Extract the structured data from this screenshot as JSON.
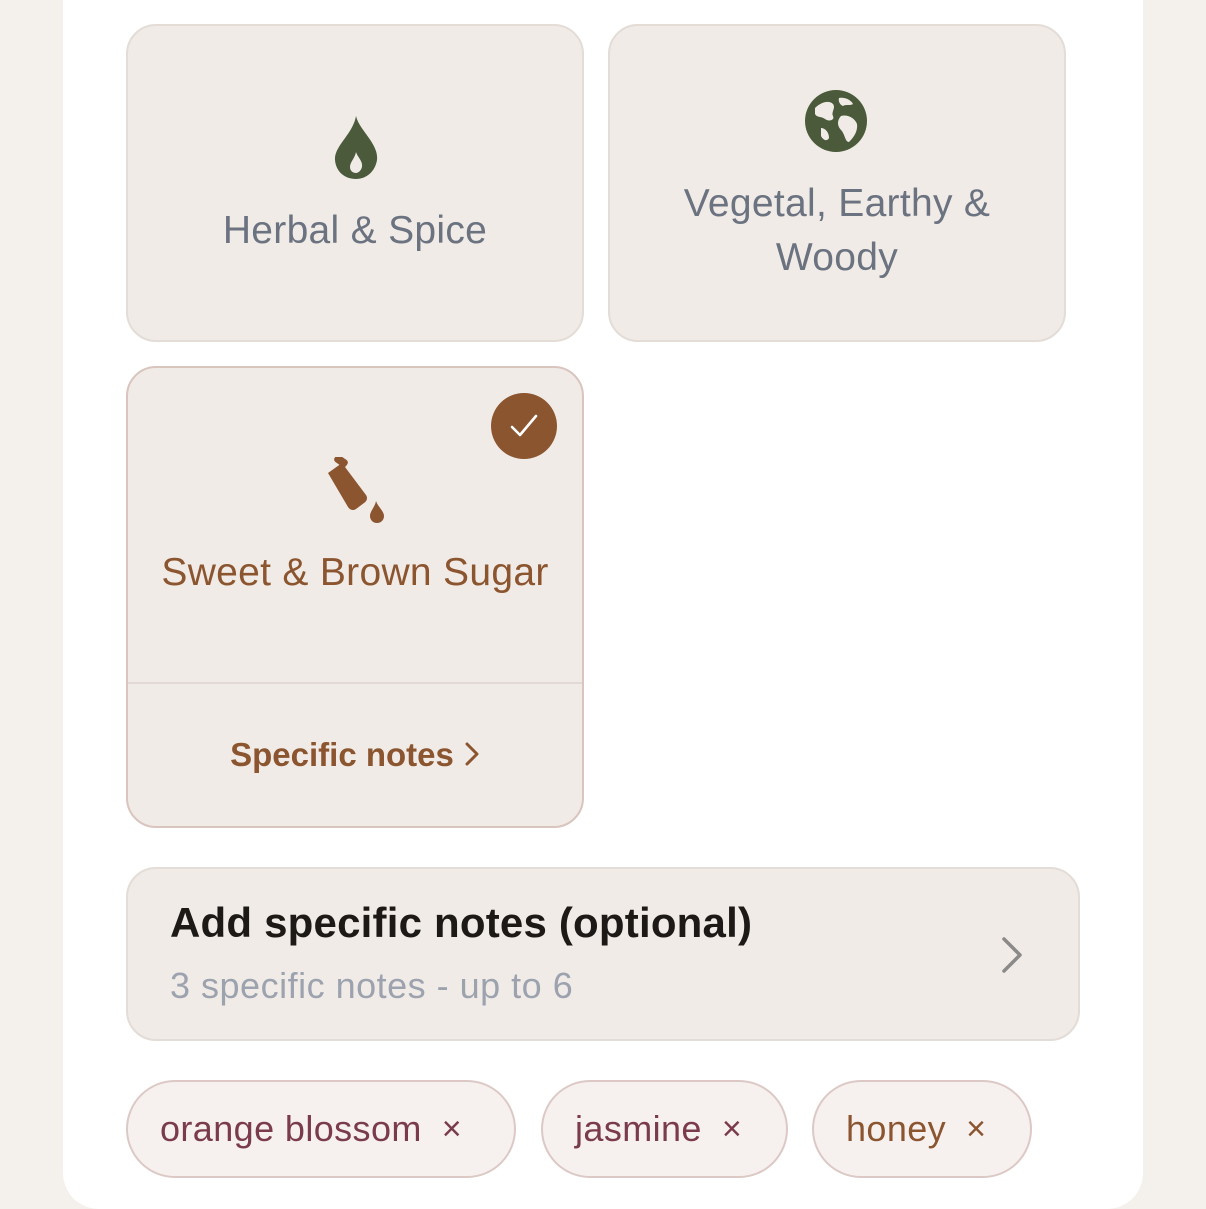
{
  "categories": [
    {
      "label": "Herbal & Spice",
      "icon": "fire-icon",
      "selected": false
    },
    {
      "label": "Vegetal, Earthy & Woody",
      "icon": "globe-icon",
      "selected": false
    },
    {
      "label": "Sweet & Brown Sugar",
      "icon": "honey-pour-icon",
      "selected": true,
      "link_label": "Specific notes"
    }
  ],
  "add_notes": {
    "title": "Add specific notes (optional)",
    "subtitle": "3 specific notes - up to 6"
  },
  "chips": [
    {
      "label": "orange blossom",
      "remove": "×"
    },
    {
      "label": "jasmine",
      "remove": "×"
    },
    {
      "label": "honey",
      "remove": "×"
    }
  ],
  "colors": {
    "accent": "#8b5530",
    "icon_green": "#4a5a3a",
    "muted_text": "#6b7280",
    "chip_floral": "#7a3b4c"
  }
}
